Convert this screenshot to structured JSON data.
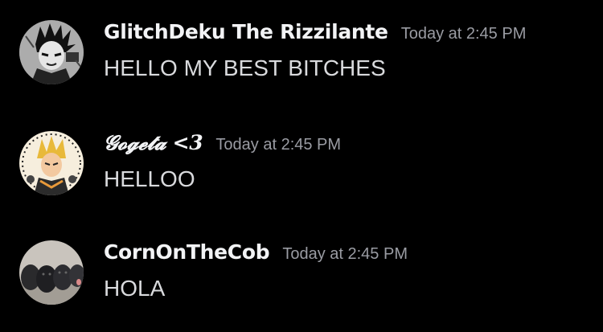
{
  "messages": [
    {
      "username": "GlitchDeku The Rizzilante",
      "timestamp": "Today at 2:45 PM",
      "content": "HELLO MY BEST BITCHES",
      "avatar": "manga-character-avatar"
    },
    {
      "username": "𝓖𝓸𝓰𝓮𝓽𝓪 <3",
      "timestamp": "Today at 2:45 PM",
      "content": "HELLOO",
      "avatar": "anime-fighter-avatar"
    },
    {
      "username": "CornOnTheCob",
      "timestamp": "Today at 2:45 PM",
      "content": "HOLA",
      "avatar": "puppies-photo-avatar"
    }
  ],
  "colors": {
    "background": "#000000",
    "username": "#f2f3f5",
    "timestamp": "#9a9ca3",
    "message_text": "#d9dadd"
  }
}
